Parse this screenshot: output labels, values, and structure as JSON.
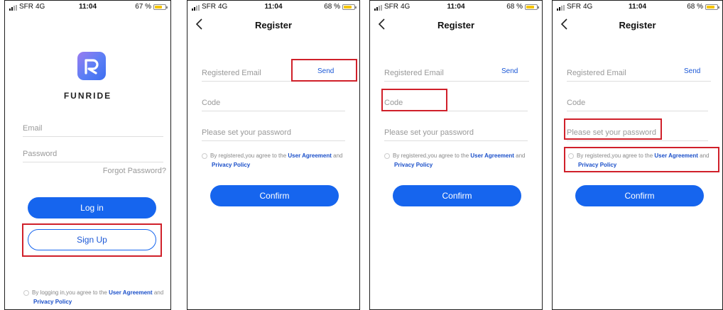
{
  "status": {
    "carrier": "SFR",
    "network": "4G",
    "time": "11:04",
    "battery_login": "67 %",
    "battery_register": "68 %"
  },
  "login": {
    "brand": "FUNRIDE",
    "email_placeholder": "Email",
    "password_placeholder": "Password",
    "forgot_label": "Forgot Password?",
    "login_label": "Log in",
    "signup_label": "Sign Up",
    "agree_prefix": "By logging in,you agree to the ",
    "agree_link1": "User Agreement",
    "agree_and": " and",
    "agree_link2": "Privacy Policy"
  },
  "register": {
    "title": "Register",
    "email_placeholder": "Registered Email",
    "send_label": "Send",
    "code_placeholder": "Code",
    "password_placeholder": "Please set your password",
    "agree_prefix": "By registered,you agree to the ",
    "agree_link1": "User Agreement",
    "agree_and": " and",
    "agree_link2": "Privacy Policy",
    "confirm_label": "Confirm"
  },
  "colors": {
    "primary": "#1665ee",
    "highlight": "#d0202a",
    "link": "#1a4fc9"
  },
  "icons": {
    "back": "chevron-left-icon",
    "logo": "funride-logo-icon"
  }
}
